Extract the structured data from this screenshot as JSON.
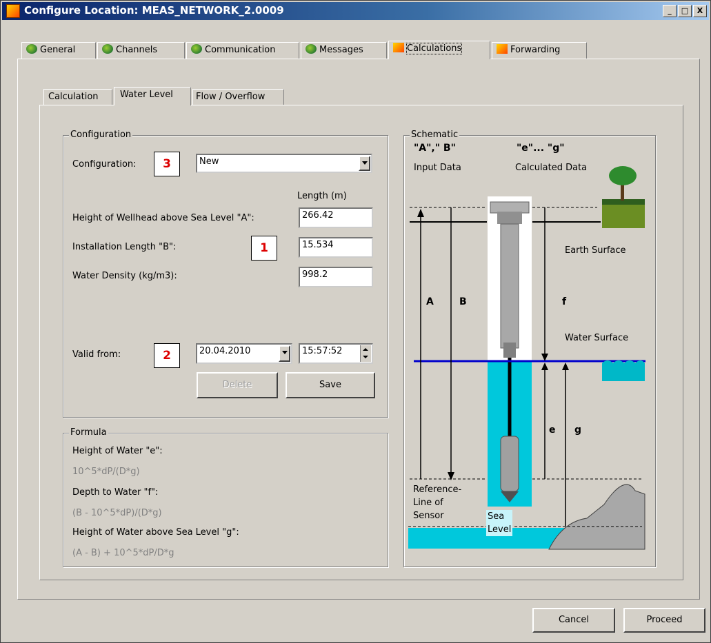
{
  "window": {
    "title": "Configure Location: MEAS_NETWORK_2.0009"
  },
  "title_buttons": {
    "minimize": "_",
    "maximize": "□",
    "close": "X"
  },
  "main_tabs": [
    {
      "label": "General",
      "icon": "globe-icon"
    },
    {
      "label": "Channels",
      "icon": "globe-icon"
    },
    {
      "label": "Communication",
      "icon": "globe-icon"
    },
    {
      "label": "Messages",
      "icon": "globe-icon"
    },
    {
      "label": "Calculations",
      "icon": "calculator-icon",
      "active": true
    },
    {
      "label": "Forwarding",
      "icon": "calculator-icon"
    }
  ],
  "sub_tabs": [
    {
      "label": "Calculation"
    },
    {
      "label": "Water Level",
      "active": true
    },
    {
      "label": "Flow / Overflow"
    }
  ],
  "configuration": {
    "group_label": "Configuration",
    "config_label": "Configuration:",
    "config_value": "New",
    "length_header": "Length (m)",
    "wellhead_label": "Height of Wellhead above Sea Level \"A\":",
    "wellhead_value": "266.42",
    "install_label": "Installation Length \"B\":",
    "install_value": "15.534",
    "density_label": "Water Density (kg/m3):",
    "density_value": "998.2",
    "valid_label": "Valid from:",
    "valid_date": "20.04.2010",
    "valid_time": "15:57:52",
    "delete_button": "Delete",
    "save_button": "Save"
  },
  "callouts": {
    "one": "1",
    "two": "2",
    "three": "3"
  },
  "formula": {
    "group_label": "Formula",
    "e_label": "Height of Water \"e\":",
    "e_formula": "10^5*dP/(D*g)",
    "f_label": "Depth to Water \"f\":",
    "f_formula": "(B - 10^5*dP)/(D*g)",
    "g_label": "Height of Water above Sea Level \"g\":",
    "g_formula": "(A - B) + 10^5*dP/D*g"
  },
  "schematic": {
    "group_label": "Schematic",
    "input_letters": "\"A\",\" B\"",
    "input_caption": "Input Data",
    "calc_letters": "\"e\"... \"g\"",
    "calc_caption": "Calculated Data",
    "earth_surface": "Earth Surface",
    "water_surface": "Water Surface",
    "ref_line_1": "Reference-",
    "ref_line_2": "Line of",
    "ref_line_3": "Sensor",
    "sea_1": "Sea",
    "sea_2": "Level",
    "label_a": "A",
    "label_b": "B",
    "label_f": "f",
    "label_e": "e",
    "label_g": "g"
  },
  "footer": {
    "cancel_button": "Cancel",
    "proceed_button": "Proceed"
  },
  "colors": {
    "water_line": "#0000cc",
    "water_fill": "#00c8dc",
    "titlebar": "#0a246a",
    "callout_text": "#dd0000"
  }
}
